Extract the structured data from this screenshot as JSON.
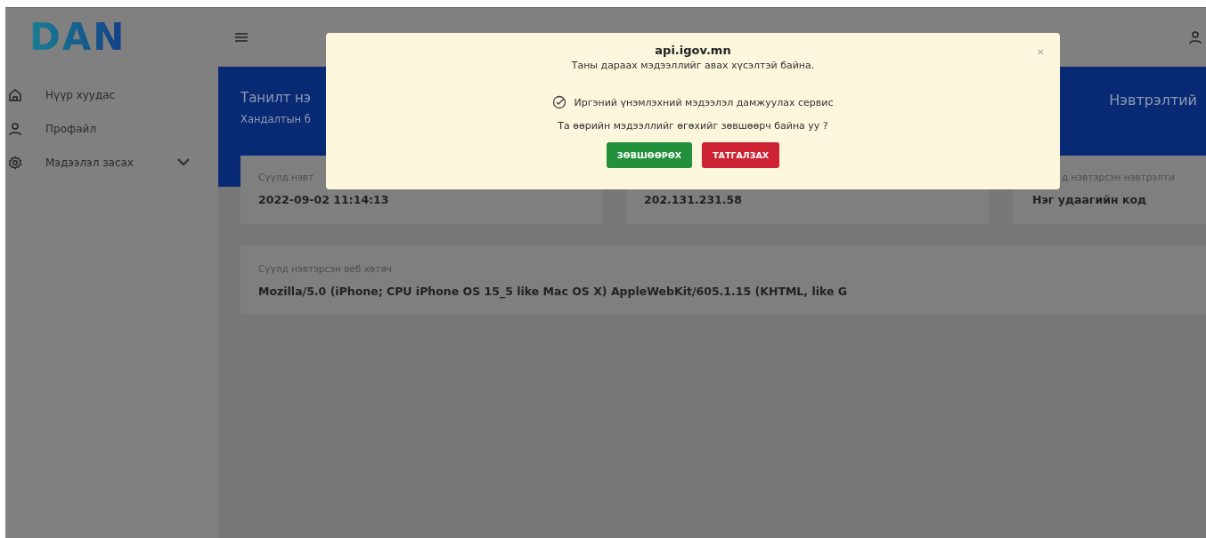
{
  "logo": {
    "text": "DAN"
  },
  "sidebar": {
    "items": [
      {
        "label": "Нүүр хуудас",
        "kind": "link"
      },
      {
        "label": "Профайл",
        "kind": "link"
      },
      {
        "label": "Мэдээлэл засах",
        "kind": "submenu"
      }
    ]
  },
  "banner": {
    "left_title": "Танилт нэ",
    "left_subtitle": "Хандалтын б",
    "right_title": "Нэвтрэлтий"
  },
  "info_cards": [
    {
      "label": "Сүүлд нэвт",
      "value": "2022-09-02 11:14:13"
    },
    {
      "value": "202.131.231.58"
    },
    {
      "label": "д нэвтэрсэн нэвтрэлти",
      "value": "Нэг удаагийн код"
    }
  ],
  "browser_card": {
    "label": "Сүүлд нэвтэрсэн веб хөтөч",
    "value": "Mozilla/5.0 (iPhone; CPU iPhone OS 15_5 like Mac OS X) AppleWebKit/605.1.15 (KHTML, like G"
  },
  "dialog": {
    "title": "api.igov.mn",
    "close": "×",
    "subtitle": "Таны дараах мэдээллийг авах хүсэлтэй байна.",
    "permissions": [
      {
        "label": "Иргэний үнэмлэхний мэдээлэл дамжуулах сервис",
        "checked": true
      }
    ],
    "question": "Та өөрийн мэдээллийг өгөхийг зөвшөөрч байна уу ?",
    "buttons": [
      {
        "label": "ЗӨВШӨӨРӨХ",
        "kind": "accept"
      },
      {
        "label": "ТАТГАЛЗАХ",
        "kind": "decline"
      }
    ]
  }
}
